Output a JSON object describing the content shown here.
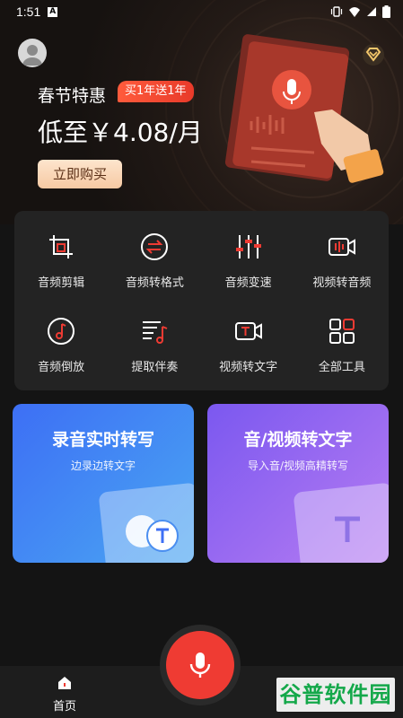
{
  "status_bar": {
    "time": "1:51"
  },
  "promo": {
    "title": "春节特惠",
    "badge": "买1年送1年",
    "price": "低至￥4.08/月",
    "buy_label": "立即购买"
  },
  "tools": [
    {
      "label": "音频剪辑",
      "icon": "crop-icon"
    },
    {
      "label": "音频转格式",
      "icon": "convert-icon"
    },
    {
      "label": "音频变速",
      "icon": "sliders-icon"
    },
    {
      "label": "视频转音频",
      "icon": "video-to-audio-icon"
    },
    {
      "label": "音频倒放",
      "icon": "music-note-icon"
    },
    {
      "label": "提取伴奏",
      "icon": "playlist-icon"
    },
    {
      "label": "视频转文字",
      "icon": "video-text-icon"
    },
    {
      "label": "全部工具",
      "icon": "grid-icon"
    }
  ],
  "cards": {
    "left": {
      "title": "录音实时转写",
      "subtitle": "边录边转文字"
    },
    "right": {
      "title": "音/视频转文字",
      "subtitle": "导入音/视频高精转写"
    }
  },
  "bottom_nav": {
    "home_label": "首页"
  },
  "watermark": "谷普软件园",
  "colors": {
    "accent_red": "#ef3b33",
    "card_blue": "#3d6ff5",
    "card_purple": "#7b58f0",
    "vip_gold": "#f3c66b"
  }
}
